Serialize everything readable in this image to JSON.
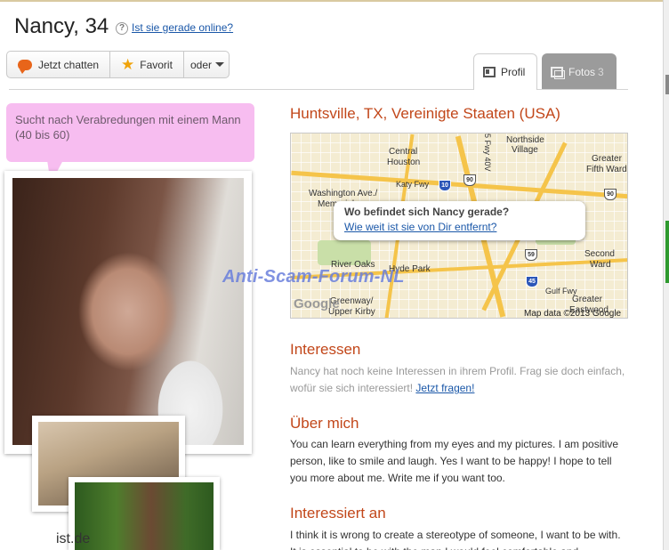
{
  "profile": {
    "name_age": "Nancy, 34",
    "help_icon": "question-icon",
    "online_link": "Ist sie gerade online?"
  },
  "actions": {
    "chat_label": "Jetzt chatten",
    "favorite_label": "Favorit",
    "more_label": "oder"
  },
  "tabs": {
    "profil_label": "Profil",
    "fotos_label": "Fotos",
    "fotos_count": "3"
  },
  "looking_for": "Sucht nach Verabredungen mit einem Mann (40 bis 60)",
  "watermark_small": "ist.de",
  "location": "Huntsville, TX, Vereinigte Staaten (USA)",
  "map": {
    "question": "Wo befindet sich Nancy gerade?",
    "distance_link": "Wie weit ist sie von Dir entfernt?",
    "google_logo": "Google",
    "attribution": "Map data ©2013 Google",
    "labels": {
      "northside": "Northside",
      "village": "Village",
      "central": "Central",
      "houston": "Houston",
      "greater1": "Greater",
      "fifth_ward": "Fifth Ward",
      "washington": "Washington Ave./",
      "memorial": "Memorial",
      "katy": "Katy Fwy",
      "river_oaks": "River Oaks",
      "hyde_park": "Hyde Park",
      "second": "Second",
      "ward": "Ward",
      "greater2": "Greater",
      "eastwood": "Eastwood",
      "greenway": "Greenway/",
      "upper_kirby": "Upper Kirby",
      "gulf_fwy": "Gulf Fwy",
      "fwy_45": "5 Fwy 40V",
      "s10": "10",
      "s90a": "90",
      "s90b": "90",
      "s59": "59",
      "s45": "45"
    }
  },
  "watermark": "Anti-Scam-Forum-NL",
  "interests": {
    "heading": "Interessen",
    "text": "Nancy hat noch keine Interessen in ihrem Profil. Frag sie doch einfach, wofür sie sich interessiert!",
    "link": "Jetzt fragen!"
  },
  "about": {
    "heading": "Über mich",
    "text": "You can learn everything from my eyes and my pictures. I am positive person, like to smile and laugh. Yes I want to be happy! I hope to tell you more about me. Write me if you want too."
  },
  "interested_in": {
    "heading": "Interessiert an",
    "text": "I think it is wrong to create a stereotype of someone, I want to be with. It is essential to be with the man I would feel comfortable and"
  },
  "colors": {
    "accent": "#c2471a",
    "link": "#1a57a8",
    "speech_bubble": "#f7bdf0"
  }
}
